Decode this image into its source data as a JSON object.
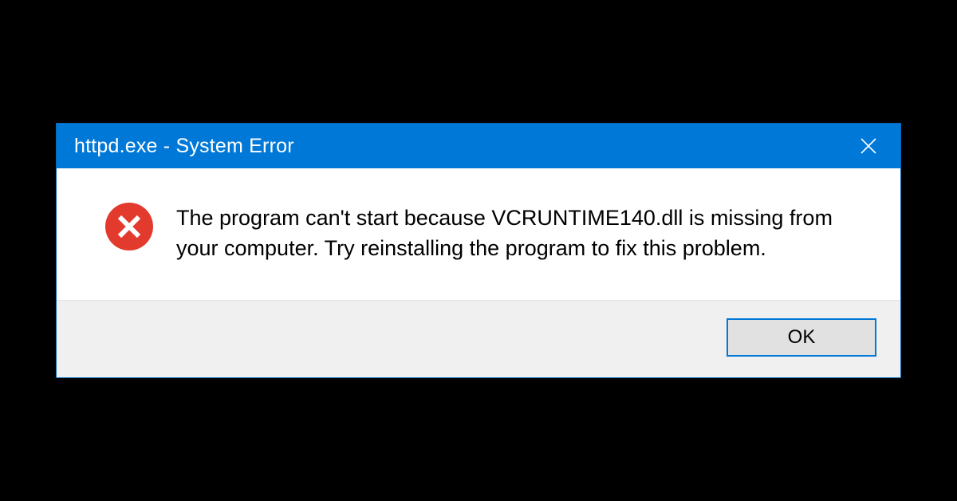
{
  "dialog": {
    "title": "httpd.exe - System Error",
    "message": "The program can't start because VCRUNTIME140.dll is missing from your computer. Try reinstalling the program to fix this problem.",
    "ok_label": "OK",
    "close_label": "Close",
    "icon": "error-icon",
    "colors": {
      "titlebar": "#0078d7",
      "error_icon": "#e23b2e",
      "footer_bg": "#f0f0f0",
      "button_bg": "#e1e1e1"
    }
  }
}
